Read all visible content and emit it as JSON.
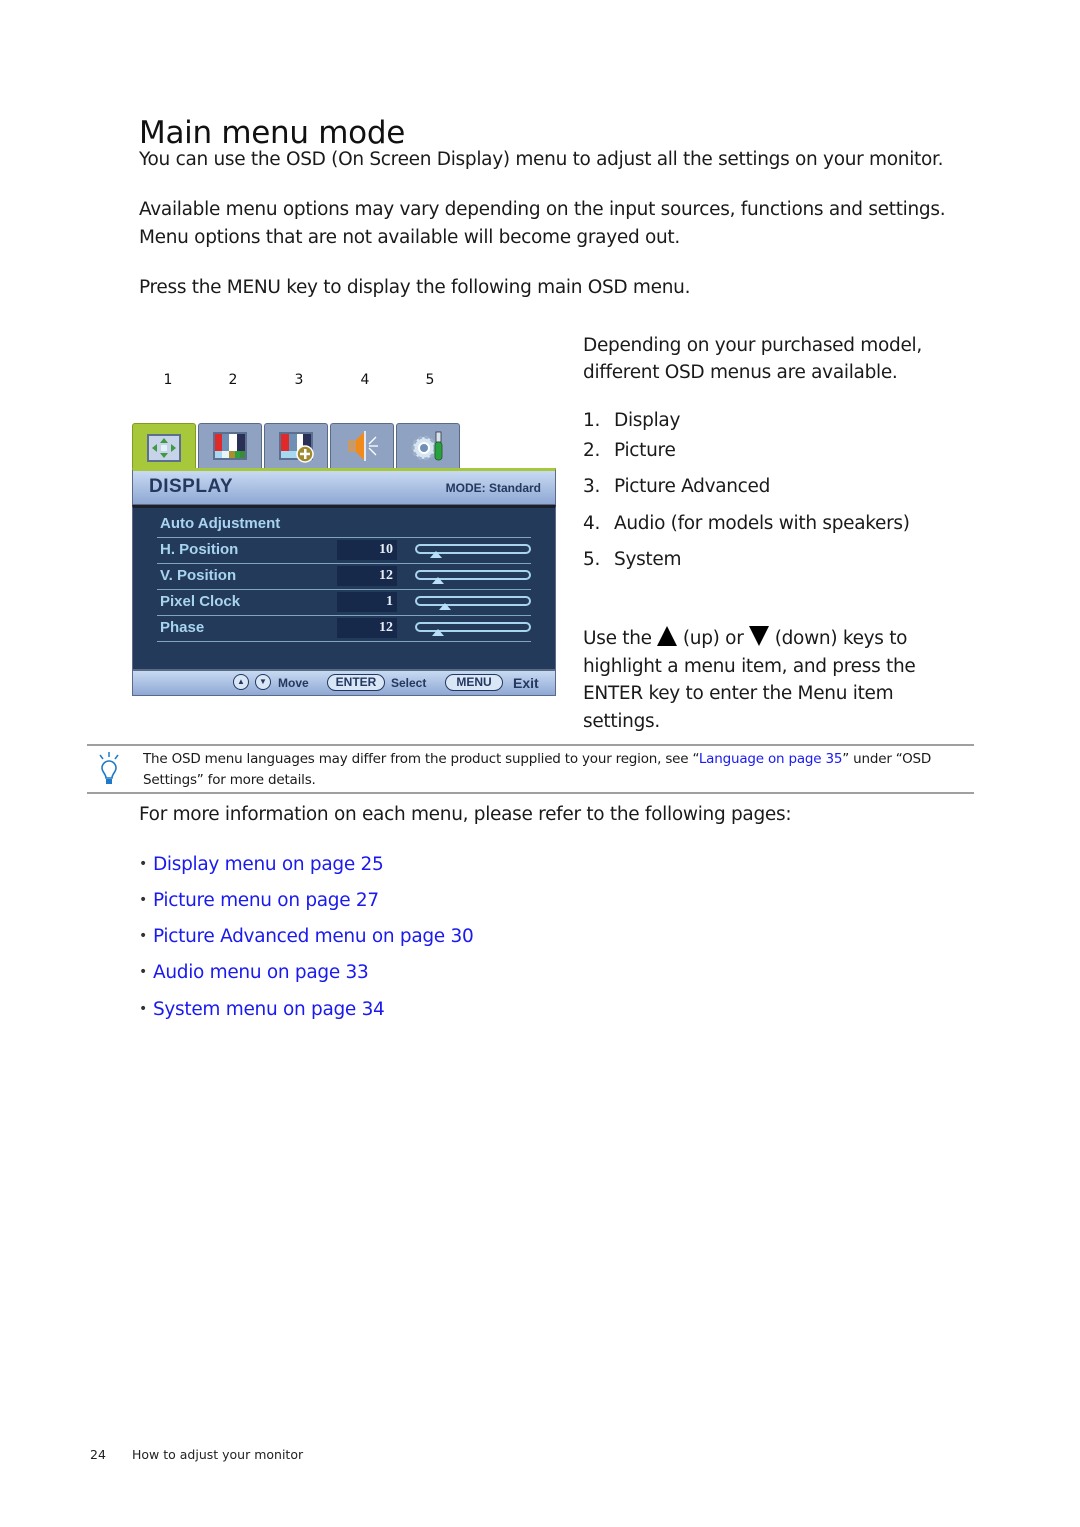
{
  "page": {
    "title": "Main menu mode",
    "paragraphs": [
      "You can use the OSD (On Screen Display) menu to adjust all the settings on your monitor.",
      "Available menu options may vary depending on the input sources, functions and settings. Menu options that are not available will become grayed out.",
      "Press the MENU key to display the following main OSD menu."
    ]
  },
  "osd": {
    "callouts": [
      "1",
      "2",
      "3",
      "4",
      "5"
    ],
    "tabs": [
      {
        "icon": "display-arrows-icon",
        "active": true
      },
      {
        "icon": "picture-color-bars-icon",
        "active": false
      },
      {
        "icon": "picture-advanced-icon",
        "active": false
      },
      {
        "icon": "audio-speaker-icon",
        "active": false
      },
      {
        "icon": "system-gear-wrench-icon",
        "active": false
      }
    ],
    "header_title": "DISPLAY",
    "mode_label": "MODE: Standard",
    "items": [
      {
        "label": "Auto Adjustment"
      },
      {
        "label": "H. Position",
        "value": "10",
        "slider_fraction": 0.1
      },
      {
        "label": "V. Position",
        "value": "12",
        "slider_fraction": 0.12
      },
      {
        "label": "Pixel Clock",
        "value": "1",
        "slider_fraction": 0.2
      },
      {
        "label": "Phase",
        "value": "12",
        "slider_fraction": 0.12
      }
    ],
    "footer": {
      "move_label": "Move",
      "enter_key": "ENTER",
      "select_label": "Select",
      "menu_key": "MENU",
      "exit_label": "Exit",
      "up_glyph": "▲",
      "down_glyph": "▼"
    }
  },
  "right_column": {
    "intro": "Depending on your purchased model, different OSD menus are available.",
    "menus": [
      {
        "num": "1.",
        "label": "Display"
      },
      {
        "num": "2.",
        "label": "Picture"
      },
      {
        "num": "3.",
        "label": "Picture Advanced"
      },
      {
        "num": "4.",
        "label": "Audio (for models with speakers)"
      },
      {
        "num": "5.",
        "label": "System"
      }
    ],
    "use_prefix": "Use the",
    "up_text": "(up) or",
    "down_text": "(down) keys to highlight a menu item, and press the",
    "enter_key": "ENTER",
    "use_suffix": "key to enter the Menu item settings."
  },
  "note": {
    "icon": "lightbulb-icon",
    "text_before": "The OSD menu languages may differ from the product supplied to your region, see “",
    "link": "Language on page 35",
    "text_after": "” under “OSD Settings” for more details."
  },
  "more_info": "For more information on each menu, please refer to the following pages:",
  "links": [
    "Display menu on page 25",
    "Picture menu on page 27",
    "Picture Advanced menu on page 30",
    "Audio menu on page 33",
    "System menu on page 34"
  ],
  "footer": {
    "page_number": "24",
    "section": "How to adjust your monitor"
  },
  "colors": {
    "link": "#1a1aee",
    "osd_active_tab": "#a7c83a",
    "osd_body": "#233a5a",
    "osd_label": "#a8d4f0"
  }
}
